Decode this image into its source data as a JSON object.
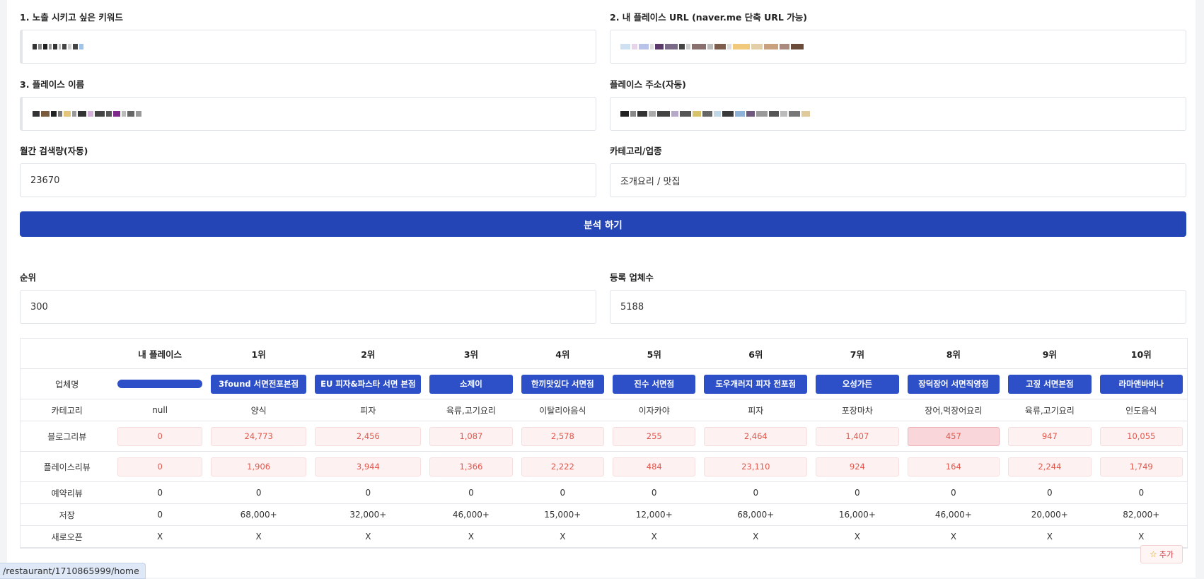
{
  "form": {
    "keyword": {
      "label": "1. 노출 시키고 싶은 키워드"
    },
    "place_url": {
      "label": "2. 내 플레이스 URL (naver.me 단축 URL 가능)"
    },
    "place_name": {
      "label": "3. 플레이스 이름"
    },
    "place_address": {
      "label": "플레이스 주소(자동)"
    },
    "monthly_search": {
      "label": "월간 검색량(자동)",
      "value": "23670"
    },
    "category": {
      "label": "카테고리/업종",
      "value": "조개요리 / 맛집"
    },
    "analyze_button": "분석 하기",
    "rank": {
      "label": "순위",
      "value": "300"
    },
    "registered_count": {
      "label": "등록 업체수",
      "value": "5188"
    }
  },
  "table": {
    "headers": [
      "",
      "내 플레이스",
      "1위",
      "2위",
      "3위",
      "4위",
      "5위",
      "6위",
      "7위",
      "8위",
      "9위",
      "10위"
    ],
    "row_labels": {
      "name": "업체명",
      "category": "카테고리",
      "blog_review": "블로그리뷰",
      "place_review": "플레이스리뷰",
      "booking_review": "예약리뷰",
      "saves": "저장",
      "new_open": "새로오픈"
    },
    "names": [
      "",
      "3found 서면전포본점",
      "EU 피자&파스타 서면 본점",
      "소제이",
      "한끼맛있다 서면점",
      "진수 서면점",
      "도우개러지 피자 전포점",
      "오성가든",
      "장덕장어 서면직영점",
      "고짚 서면본점",
      "라마앤바바나"
    ],
    "categories": [
      "null",
      "양식",
      "피자",
      "육류,고기요리",
      "이탈리아음식",
      "이자카야",
      "피자",
      "포장마차",
      "장어,먹장어요리",
      "육류,고기요리",
      "인도음식"
    ],
    "blog_reviews": [
      "0",
      "24,773",
      "2,456",
      "1,087",
      "2,578",
      "255",
      "2,464",
      "1,407",
      "457",
      "947",
      "10,055"
    ],
    "place_reviews": [
      "0",
      "1,906",
      "3,944",
      "1,366",
      "2,222",
      "484",
      "23,110",
      "924",
      "164",
      "2,244",
      "1,749"
    ],
    "booking_reviews": [
      "0",
      "0",
      "0",
      "0",
      "0",
      "0",
      "0",
      "0",
      "0",
      "0",
      "0"
    ],
    "saves": [
      "0",
      "68,000+",
      "32,000+",
      "46,000+",
      "15,000+",
      "12,000+",
      "68,000+",
      "16,000+",
      "46,000+",
      "20,000+",
      "82,000+"
    ],
    "new_open": [
      "X",
      "X",
      "X",
      "X",
      "X",
      "X",
      "X",
      "X",
      "X",
      "X",
      "X"
    ]
  },
  "add_button": {
    "icon": "star-icon",
    "label": "추가"
  },
  "status_url": "/restaurant/1710865999/home",
  "colors": {
    "primary": "#2445b6",
    "button": "#2d50c8",
    "metric_text": "#e2574c",
    "metric_bg": "#fdf1f1",
    "highlight_bg": "#f8d6d9"
  }
}
